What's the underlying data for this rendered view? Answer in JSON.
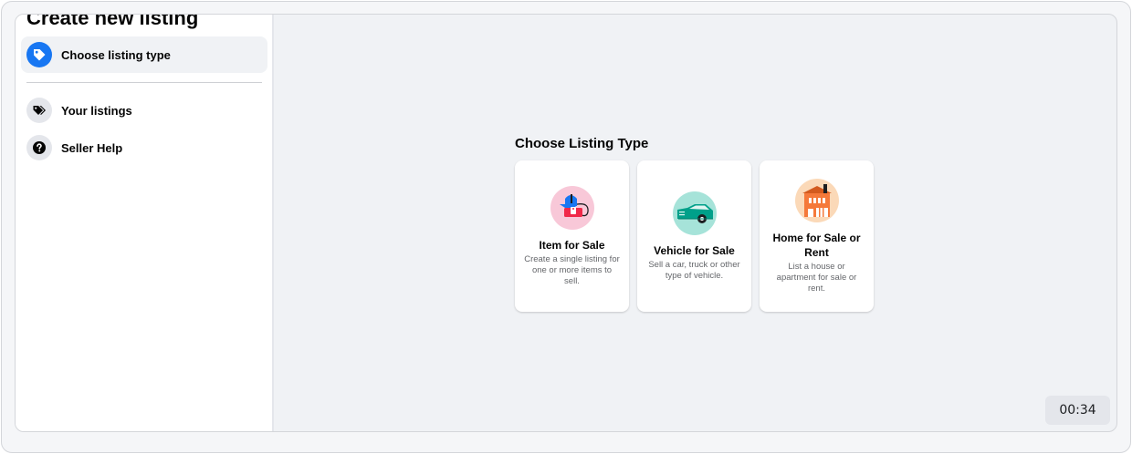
{
  "sidebar": {
    "title": "Create new listing",
    "items": [
      {
        "label": "Choose listing type",
        "icon": "tag-icon",
        "active": true
      },
      {
        "label": "Your listings",
        "icon": "tags-icon",
        "active": false
      },
      {
        "label": "Seller Help",
        "icon": "question-icon",
        "active": false
      }
    ]
  },
  "main": {
    "heading": "Choose Listing Type",
    "cards": [
      {
        "title": "Item for Sale",
        "description": "Create a single listing for one or more items to sell.",
        "icon": "item-for-sale-illustration"
      },
      {
        "title": "Vehicle for Sale",
        "description": "Sell a car, truck or other type of vehicle.",
        "icon": "vehicle-illustration"
      },
      {
        "title": "Home for Sale or Rent",
        "description": "List a house or apartment for sale or rent.",
        "icon": "home-illustration"
      }
    ]
  },
  "timer": {
    "value": "00:34"
  },
  "colors": {
    "accent": "#1877f2",
    "canvas": "#f0f2f5",
    "item_bg": "#f8c8d8",
    "vehicle_bg": "#a6e3d9",
    "home_bg": "#fbd9b8"
  }
}
